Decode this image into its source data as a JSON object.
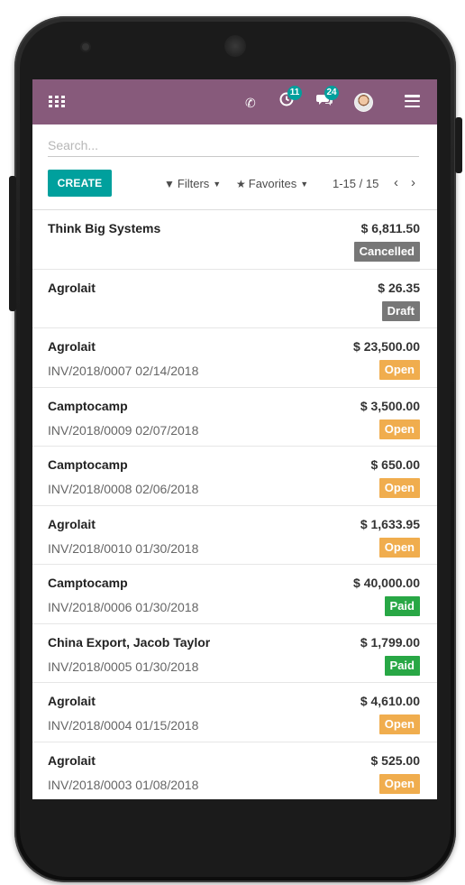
{
  "topbar": {
    "activity_badge": "11",
    "messages_badge": "24"
  },
  "search": {
    "placeholder": "Search...",
    "value": ""
  },
  "controls": {
    "create_label": "CREATE",
    "filters_label": "Filters",
    "favorites_label": "Favorites",
    "pager_text": "1-15 / 15",
    "prev_glyph": "‹",
    "next_glyph": "›"
  },
  "icons": {
    "apps": "apps-grid-icon",
    "phone": "phone-icon",
    "activity": "clock-icon",
    "messages": "chat-icon",
    "menu": "hamburger-icon",
    "filter": "funnel-icon",
    "favorite": "star-icon"
  },
  "colors": {
    "brand": "#875a7b",
    "primary": "#00a09d",
    "open": "#f0ad4e",
    "paid": "#28a745",
    "muted": "#777777"
  },
  "invoices": [
    {
      "partner": "Think Big Systems",
      "ref": "",
      "date": "",
      "amount": "$ 6,811.50",
      "state": "Cancelled",
      "state_class": "cancelled"
    },
    {
      "partner": "Agrolait",
      "ref": "",
      "date": "",
      "amount": "$ 26.35",
      "state": "Draft",
      "state_class": "draft"
    },
    {
      "partner": "Agrolait",
      "ref": "INV/2018/0007",
      "date": "02/14/2018",
      "amount": "$ 23,500.00",
      "state": "Open",
      "state_class": "open"
    },
    {
      "partner": "Camptocamp",
      "ref": "INV/2018/0009",
      "date": "02/07/2018",
      "amount": "$ 3,500.00",
      "state": "Open",
      "state_class": "open"
    },
    {
      "partner": "Camptocamp",
      "ref": "INV/2018/0008",
      "date": "02/06/2018",
      "amount": "$ 650.00",
      "state": "Open",
      "state_class": "open"
    },
    {
      "partner": "Agrolait",
      "ref": "INV/2018/0010",
      "date": "01/30/2018",
      "amount": "$ 1,633.95",
      "state": "Open",
      "state_class": "open"
    },
    {
      "partner": "Camptocamp",
      "ref": "INV/2018/0006",
      "date": "01/30/2018",
      "amount": "$ 40,000.00",
      "state": "Paid",
      "state_class": "paid"
    },
    {
      "partner": "China Export, Jacob Taylor",
      "ref": "INV/2018/0005",
      "date": "01/30/2018",
      "amount": "$ 1,799.00",
      "state": "Paid",
      "state_class": "paid"
    },
    {
      "partner": "Agrolait",
      "ref": "INV/2018/0004",
      "date": "01/15/2018",
      "amount": "$ 4,610.00",
      "state": "Open",
      "state_class": "open"
    },
    {
      "partner": "Agrolait",
      "ref": "INV/2018/0003",
      "date": "01/08/2018",
      "amount": "$ 525.00",
      "state": "Open",
      "state_class": "open"
    }
  ]
}
